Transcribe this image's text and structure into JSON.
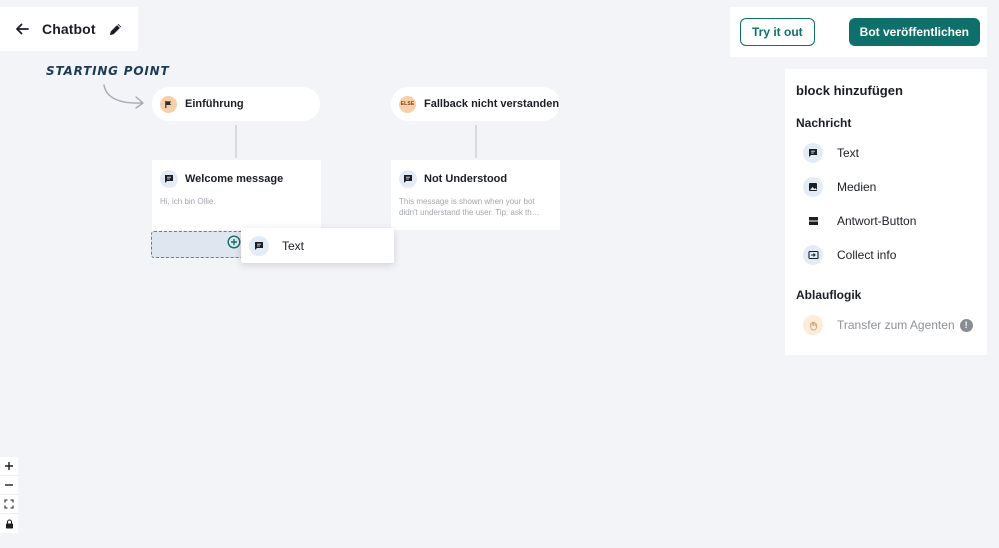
{
  "header": {
    "title": "Chatbot",
    "try_label": "Try it out",
    "publish_label": "Bot veröffentlichen"
  },
  "canvas": {
    "starting_point_label": "STARTING POINT",
    "nodes": [
      {
        "label": "Einführung",
        "icon": "flag-icon"
      },
      {
        "label": "Fallback nicht verstanden",
        "icon": "else-icon",
        "tag": "ELSE"
      }
    ],
    "cards": [
      {
        "title": "Welcome message",
        "body": "Hi, ich bin Ollie.",
        "icon": "message-icon"
      },
      {
        "title": "Not Understood",
        "body": "This message is shown when your bot didn't understand the user. Tip: ask th…",
        "icon": "message-icon"
      }
    ],
    "drag_ghost": {
      "label": "Text",
      "icon": "message-icon"
    }
  },
  "side_panel": {
    "title": "block hinzufügen",
    "sections": [
      {
        "label": "Nachricht",
        "items": [
          {
            "label": "Text",
            "icon": "message-icon"
          },
          {
            "label": "Medien",
            "icon": "image-icon"
          },
          {
            "label": "Antwort-Button",
            "icon": "button-icon"
          },
          {
            "label": "Collect info",
            "icon": "input-icon"
          }
        ]
      },
      {
        "label": "Ablauflogik",
        "items": [
          {
            "label": "Transfer zum Agenten",
            "icon": "hand-icon",
            "badge": "!",
            "disabled": true
          }
        ]
      }
    ]
  },
  "colors": {
    "brand": "#0f6f6a",
    "background": "#f3f4f8",
    "node_accent": "#f7cfa8",
    "icon_bg": "#e3ecf6"
  }
}
